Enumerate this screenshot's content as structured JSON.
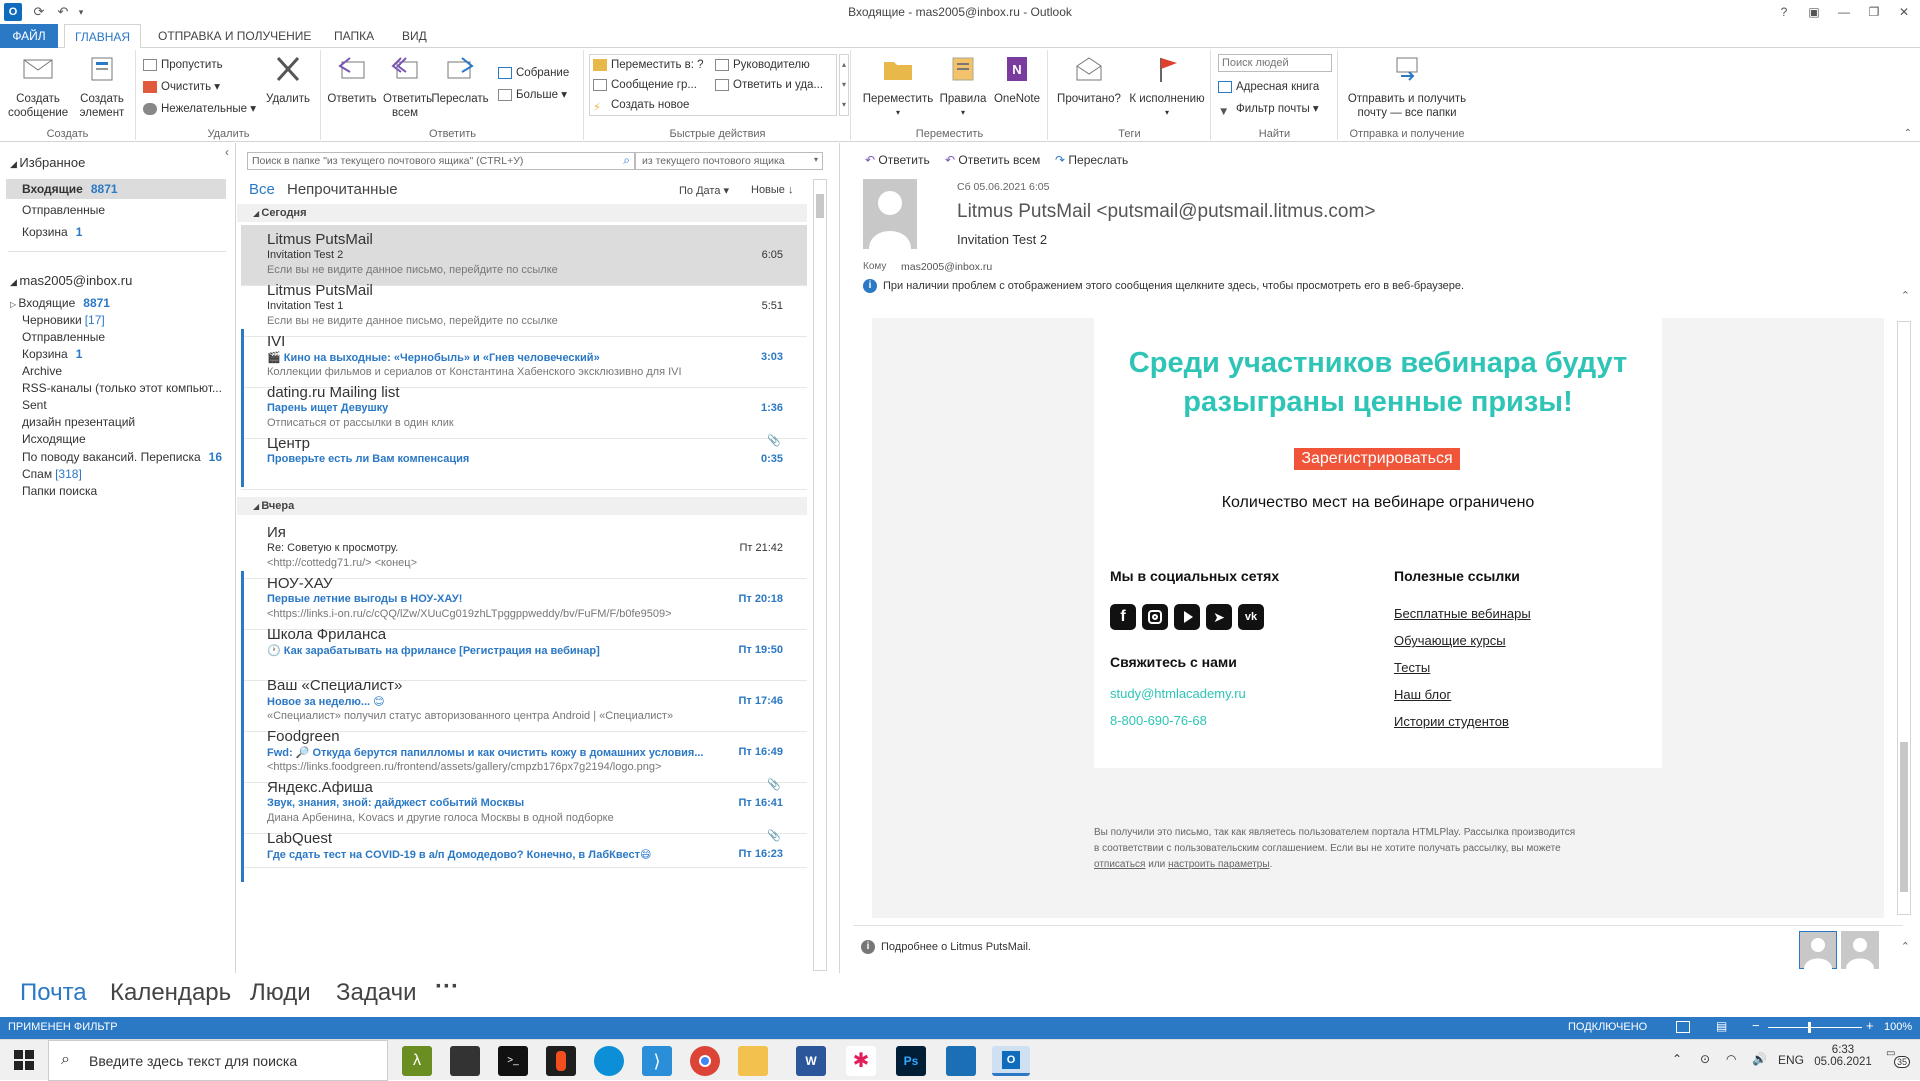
{
  "window": {
    "title": "Входящие - mas2005@inbox.ru - Outlook"
  },
  "tabs": [
    "ФАЙЛ",
    "ГЛАВНАЯ",
    "ОТПРАВКА И ПОЛУЧЕНИЕ",
    "ПАПКА",
    "ВИД"
  ],
  "ribbon": {
    "create_message": "Создать сообщение",
    "create_item": "Создать элемент",
    "group_create": "Создать",
    "skip": "Пропустить",
    "clean": "Очистить",
    "junk": "Нежелательные",
    "delete": "Удалить",
    "group_delete": "Удалить",
    "reply": "Ответить",
    "reply_all": "Ответить всем",
    "forward": "Переслать",
    "meeting": "Собрание",
    "more": "Больше",
    "group_reply": "Ответить",
    "qs_move": "Переместить в: ?",
    "qs_to_manager": "Руководителю",
    "qs_team": "Сообщение гр...",
    "qs_reply_delete": "Ответить и уда...",
    "qs_create": "Создать новое",
    "group_quick": "Быстрые действия",
    "move": "Переместить",
    "rules": "Правила",
    "onenote": "OneNote",
    "group_move": "Переместить",
    "read": "Прочитано?",
    "followup": "К исполнению",
    "group_tags": "Теги",
    "search_people": "Поиск людей",
    "address_book": "Адресная книга",
    "filter_mail": "Фильтр почты",
    "group_find": "Найти",
    "send_receive": "Отправить и получить почту — все папки",
    "group_send": "Отправка и получение"
  },
  "nav": {
    "favorites": "Избранное",
    "fav_items": [
      {
        "label": "Входящие",
        "count": "8871"
      },
      {
        "label": "Отправленные",
        "count": ""
      },
      {
        "label": "Корзина",
        "count": "1"
      }
    ],
    "account": "mas2005@inbox.ru",
    "folders": [
      {
        "label": "Входящие",
        "count": "8871",
        "bracket": ""
      },
      {
        "label": "Черновики",
        "count": "",
        "bracket": "[17]"
      },
      {
        "label": "Отправленные",
        "count": "",
        "bracket": ""
      },
      {
        "label": "Корзина",
        "count": "1",
        "bracket": ""
      },
      {
        "label": "Archive",
        "count": "",
        "bracket": ""
      },
      {
        "label": "RSS-каналы (только этот компьют...",
        "count": "",
        "bracket": ""
      },
      {
        "label": "Sent",
        "count": "",
        "bracket": ""
      },
      {
        "label": "дизайн презентаций",
        "count": "",
        "bracket": ""
      },
      {
        "label": "Исходящие",
        "count": "",
        "bracket": ""
      },
      {
        "label": "По поводу вакансий. Переписка",
        "count": "16",
        "bracket": ""
      },
      {
        "label": "Спам",
        "count": "",
        "bracket": "[318]"
      },
      {
        "label": "Папки поиска",
        "count": "",
        "bracket": ""
      }
    ]
  },
  "list": {
    "search_placeholder": "Поиск в папке \"из текущего почтового ящика\" (CTRL+У)",
    "scope": "из текущего почтового ящика",
    "filter_all": "Все",
    "filter_unread": "Непрочитанные",
    "sort_by": "По Дата",
    "sort_order": "Новые",
    "today": "Сегодня",
    "yesterday": "Вчера",
    "messages": [
      {
        "from": "Litmus PutsMail",
        "subject": "Invitation Test 2",
        "preview": "Если вы не видите данное письмо, перейдите по ссылке",
        "time": "6:05",
        "unread": false,
        "selected": true,
        "attach": false
      },
      {
        "from": "Litmus PutsMail",
        "subject": "Invitation Test 1",
        "preview": "Если вы не видите данное письмо, перейдите по ссылке",
        "time": "5:51",
        "unread": false,
        "selected": false,
        "attach": false
      },
      {
        "from": "IVI",
        "subject": "🎬 Кино на выходные: «Чернобыль» и «Гнев человеческий»",
        "preview": "Коллекции фильмов и сериалов от Константина Хабенского эксклюзивно для IVI",
        "time": "3:03",
        "unread": true,
        "selected": false,
        "attach": false
      },
      {
        "from": "dating.ru Mailing list",
        "subject": "Парень ищет Девушку",
        "preview": "Отписаться от рассылки в один клик",
        "time": "1:36",
        "unread": true,
        "selected": false,
        "attach": false
      },
      {
        "from": "Центр",
        "subject": "Проверьте есть ли Вам компенсация",
        "preview": "",
        "time": "0:35",
        "unread": true,
        "selected": false,
        "attach": true
      },
      {
        "from": "Ия",
        "subject": "Re: Советую к просмотру.",
        "preview": "<http://cottedg71.ru/>  <конец>",
        "time": "Пт 21:42",
        "unread": false,
        "selected": false,
        "attach": false
      },
      {
        "from": "НОУ-ХАУ",
        "subject": "Первые летние выгоды в НОУ-ХАУ!",
        "preview": "<https://links.i-on.ru/c/cQQ/lZw/XUuCg019zhLTpggppweddy/bv/FuFM/F/b0fe9509>",
        "time": "Пт 20:18",
        "unread": true,
        "selected": false,
        "attach": false
      },
      {
        "from": "Школа Фриланса",
        "subject": "🕐 Как зарабатывать на фрилансе [Регистрация на вебинар]",
        "preview": "",
        "time": "Пт 19:50",
        "unread": true,
        "selected": false,
        "attach": false
      },
      {
        "from": "Ваш «Специалист»",
        "subject": "Новое за неделю... 😊",
        "preview": "«Специалист» получил статус авторизованного центра Android | «Специалист»",
        "time": "Пт 17:46",
        "unread": true,
        "selected": false,
        "attach": false
      },
      {
        "from": "Foodgreen",
        "subject": "Fwd: 🔎 Откуда берутся папилломы и как очистить кожу в домашних условия...",
        "preview": "<https://links.foodgreen.ru/frontend/assets/gallery/cmpzb176px7g2194/logo.png>",
        "time": "Пт 16:49",
        "unread": true,
        "selected": false,
        "attach": false
      },
      {
        "from": "Яндекс.Афиша",
        "subject": "Звук, знания, зной: дайджест событий Москвы",
        "preview": "Диана Арбенина, Kovacs и другие голоса Москвы в одной подборке",
        "time": "Пт 16:41",
        "unread": true,
        "selected": false,
        "attach": true
      },
      {
        "from": "LabQuest",
        "subject": "Где сдать тест на COVID-19 в а/п Домодедово? Конечно, в ЛабКвест😄",
        "preview": "",
        "time": "Пт 16:23",
        "unread": true,
        "selected": false,
        "attach": true
      }
    ]
  },
  "reading": {
    "reply": "Ответить",
    "reply_all": "Ответить всем",
    "forward": "Переслать",
    "date": "Сб 05.06.2021 6:05",
    "sender": "Litmus PutsMail <putsmail@putsmail.litmus.com>",
    "subject": "Invitation Test 2",
    "to_label": "Кому",
    "to": "mas2005@inbox.ru",
    "info": "При наличии проблем с отображением этого сообщения щелкните здесь, чтобы просмотреть его в веб-браузере.",
    "headline": "Среди участников вебинара будут разыграны ценные призы!",
    "register": "Зарегистрироваться",
    "limited": "Количество мест на вебинаре ограничено",
    "social_title": "Мы в социальных сетях",
    "contact_title": "Свяжитесь с нами",
    "email": "study@htmlacademy.ru",
    "phone": "8-800-690-76-68",
    "links_title": "Полезные ссылки",
    "links": [
      "Бесплатные вебинары",
      "Обучающие курсы",
      "Тесты",
      "Наш блог",
      "Истории студентов"
    ],
    "footer1": "Вы получили это письмо, так как являетесь пользователем портала HTMLPlay. Рассылка производится",
    "footer2": "в соответствии с пользовательским соглашением. Если вы не хотите получать рассылку, вы можете",
    "unsubscribe": "отписаться",
    "or": " или ",
    "settings": "настроить параметры",
    "more_about": "Подробнее о Litmus PutsMail."
  },
  "bottomnav": [
    "Почта",
    "Календарь",
    "Люди",
    "Задачи",
    "···"
  ],
  "status": {
    "filter": "ПРИМЕНЕН ФИЛЬТР",
    "connected": "ПОДКЛЮЧЕНО",
    "zoom": "100%"
  },
  "taskbar": {
    "search": "Введите здесь текст для поиска",
    "lang": "ENG",
    "time": "6:33",
    "date": "05.06.2021",
    "notif": "35"
  },
  "colors": {
    "accent": "#2b78c5",
    "teal": "#2ec4b6",
    "register_bg": "#f0553a"
  }
}
